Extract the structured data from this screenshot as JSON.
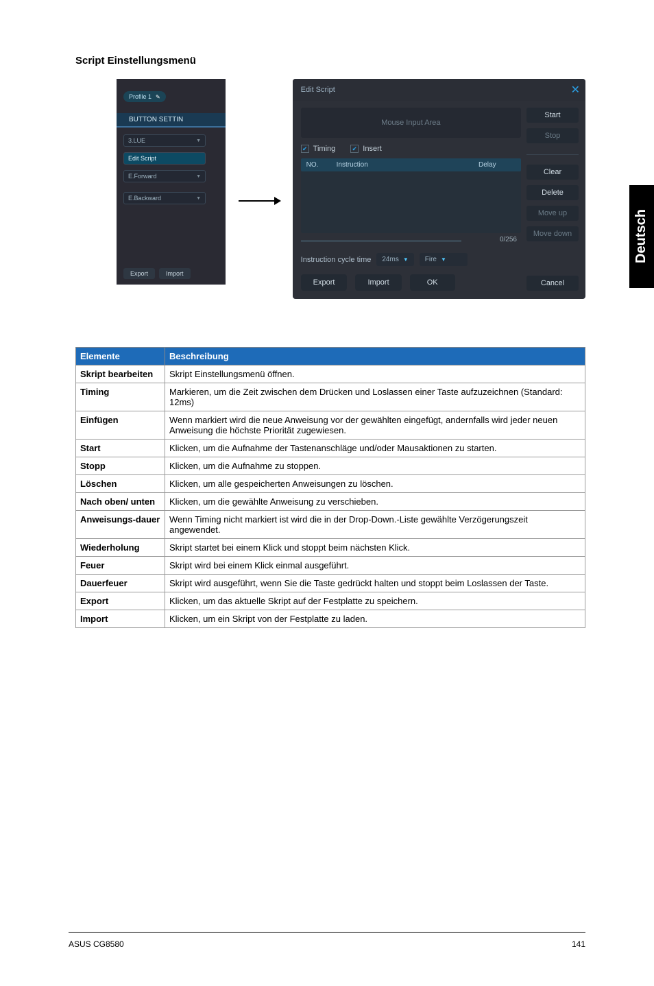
{
  "section_title": "Script Einstellungsmenü",
  "settings_panel": {
    "tab_button": "BUTTON SETTIN",
    "profile_pill": "Profile 1",
    "dropdowns": [
      "3.LUE",
      "Edit Script",
      "E.Forward",
      "E.Backward"
    ],
    "export_btn": "Export",
    "import_btn": "Import"
  },
  "edit_window": {
    "title": "Edit Script",
    "close": "✕",
    "input_area_placeholder": "Mouse Input Area",
    "timing_cb": "Timing",
    "insert_cb": "Insert",
    "grid": {
      "no": "NO.",
      "instruction": "Instruction",
      "delay": "Delay"
    },
    "counter": "0/256",
    "cycle_label": "Instruction cycle time",
    "cycle_value": "24ms",
    "mode_value": "Fire",
    "btn_start": "Start",
    "btn_stop": "Stop",
    "btn_clear": "Clear",
    "btn_delete": "Delete",
    "btn_move_up": "Move up",
    "btn_move_down": "Move down",
    "btn_export": "Export",
    "btn_import": "Import",
    "btn_ok": "OK",
    "btn_cancel": "Cancel"
  },
  "sidebar_language": "Deutsch",
  "table": {
    "head": {
      "elem": "Elemente",
      "desc": "Beschreibung"
    },
    "rows": [
      {
        "k": "Skript bearbeiten",
        "v": "Skript Einstellungsmenü öffnen."
      },
      {
        "k": "Timing",
        "v": "Markieren, um die Zeit zwischen dem Drücken und Loslassen einer Taste aufzuzeichnen (Standard: 12ms)"
      },
      {
        "k": "Einfügen",
        "v": "Wenn markiert wird die neue Anweisung vor der gewählten eingefügt, andernfalls wird jeder neuen Anweisung die höchste Priorität zugewiesen."
      },
      {
        "k": "Start",
        "v": "Klicken, um die Aufnahme der Tastenanschläge und/oder Mausaktionen zu starten."
      },
      {
        "k": "Stopp",
        "v": "Klicken, um die Aufnahme zu stoppen."
      },
      {
        "k": "Löschen",
        "v": "Klicken, um alle gespeicherten Anweisungen zu löschen."
      },
      {
        "k": "Nach oben/ unten",
        "v": "Klicken, um die gewählte Anweisung zu verschieben."
      },
      {
        "k": "Anweisungs-dauer",
        "v": "Wenn Timing nicht markiert ist wird die in der Drop-Down.-Liste gewählte Verzögerungszeit angewendet."
      },
      {
        "k": "Wiederholung",
        "v": "Skript startet bei einem Klick und stoppt beim nächsten Klick."
      },
      {
        "k": "Feuer",
        "v": "Skript wird bei einem Klick einmal ausgeführt."
      },
      {
        "k": "Dauerfeuer",
        "v": "Skript wird ausgeführt, wenn Sie die Taste gedrückt halten und stoppt beim Loslassen der Taste."
      },
      {
        "k": "Export",
        "v": "Klicken, um das aktuelle Skript auf der Festplatte zu speichern."
      },
      {
        "k": "Import",
        "v": "Klicken, um ein Skript von der Festplatte zu laden."
      }
    ]
  },
  "footer": {
    "left": "ASUS CG8580",
    "right": "141"
  }
}
